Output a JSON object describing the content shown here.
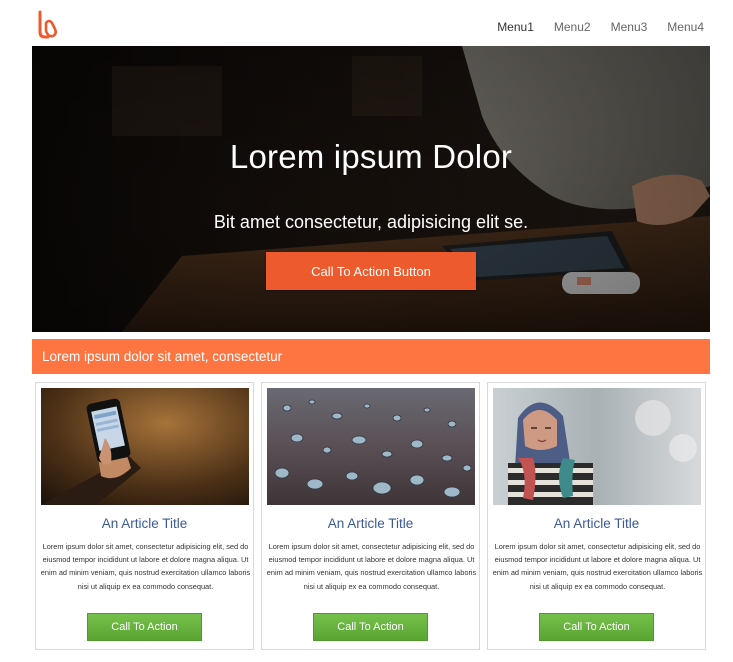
{
  "header": {
    "logo_icon": "lx-logo-icon",
    "nav": [
      {
        "label": "Menu1"
      },
      {
        "label": "Menu2"
      },
      {
        "label": "Menu3"
      },
      {
        "label": "Menu4"
      }
    ]
  },
  "hero": {
    "title": "Lorem ipsum Dolor",
    "subtitle": "Bit amet consectetur, adipisicing elit se.",
    "cta_label": "Call To Action Button",
    "cta_color": "#ec5a2d"
  },
  "banner": {
    "text": "Lorem ipsum dolor sit amet, consectetur",
    "color": "#ff7541"
  },
  "cards": [
    {
      "image": "hand-holding-phone-photo",
      "title": "An Article Title",
      "text": "Lorem ipsum dolor sit amet, consectetur adipisicing elit, sed do eiusmod tempor incididunt ut labore et dolore magna aliqua. Ut enim ad minim veniam, quis nostrud exercitation ullamco laboris nisi ut aliquip ex ea commodo consequat.",
      "button_label": "Call To Action"
    },
    {
      "image": "water-droplets-photo",
      "title": "An Article Title",
      "text": "Lorem ipsum dolor sit amet, consectetur adipisicing elit, sed do eiusmod tempor incididunt ut labore et dolore magna aliqua. Ut enim ad minim veniam, quis nostrud exercitation ullamco laboris nisi ut aliquip ex ea commodo consequat.",
      "button_label": "Call To Action"
    },
    {
      "image": "woman-in-scarf-photo",
      "title": "An Article Title",
      "text": "Lorem ipsum dolor sit amet, consectetur adipisicing elit, sed do eiusmod tempor incididunt ut labore et dolore magna aliqua. Ut enim ad minim veniam, quis nostrud exercitation ullamco laboris nisi ut aliquip ex ea commodo consequat.",
      "button_label": "Call To Action"
    }
  ]
}
